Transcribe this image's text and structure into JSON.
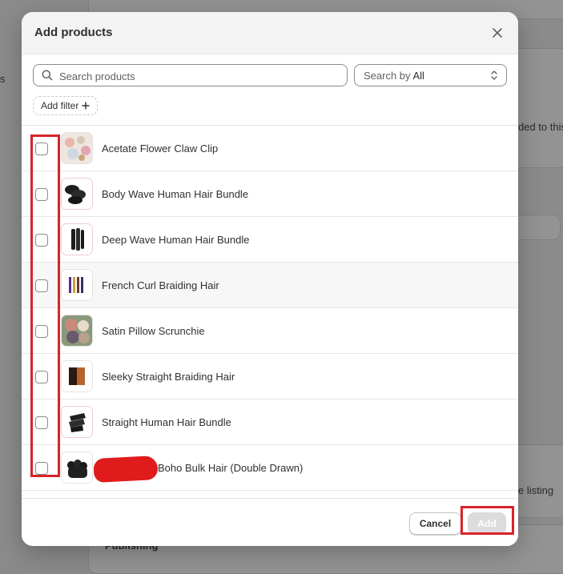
{
  "modal": {
    "title": "Add products",
    "search": {
      "placeholder": "Search products",
      "value": ""
    },
    "search_by": {
      "label": "Search by",
      "value": "All"
    },
    "add_filter_label": "Add filter",
    "products": [
      {
        "name": "Acetate Flower Claw Clip",
        "thumb": "claw-clip"
      },
      {
        "name": "Body Wave Human Hair Bundle",
        "thumb": "hair-bundle"
      },
      {
        "name": "Deep Wave Human Hair Bundle",
        "thumb": "hair-bundle"
      },
      {
        "name": "French Curl Braiding Hair",
        "thumb": "braiding-hair"
      },
      {
        "name": "Satin Pillow Scrunchie",
        "thumb": "scrunchie"
      },
      {
        "name": "Sleeky Straight Braiding Hair",
        "thumb": "braiding-hair"
      },
      {
        "name": "Straight Human Hair Bundle",
        "thumb": "hair-bundle"
      },
      {
        "name": "Boho Bulk Hair (Double Drawn)",
        "thumb": "hair-bundle",
        "redacted_prefix": true
      }
    ],
    "footer": {
      "cancel_label": "Cancel",
      "add_label": "Add"
    }
  },
  "background": {
    "text_1": "s",
    "text_2": "ded to this",
    "text_3": "e listing",
    "text_4": "Publishing"
  },
  "colors": {
    "annotation": "#d8232a",
    "redaction": "#e01b1b"
  }
}
